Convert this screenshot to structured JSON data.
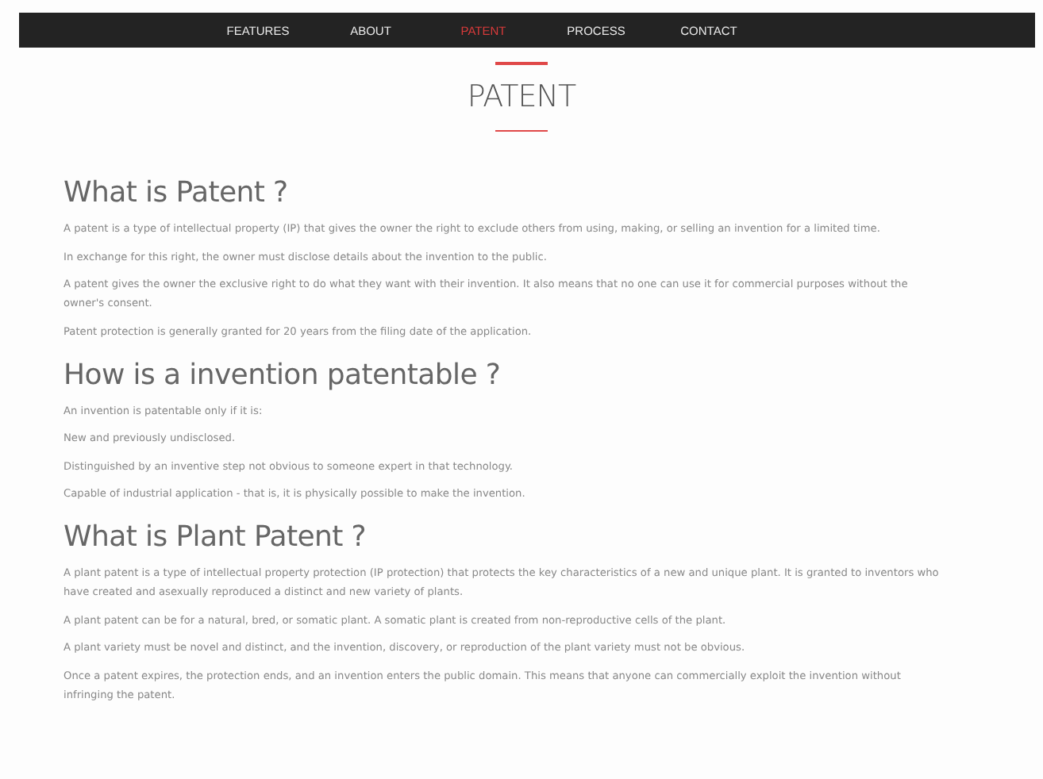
{
  "nav": {
    "items": [
      {
        "label": "FEATURES",
        "selected": false
      },
      {
        "label": "ABOUT",
        "selected": false
      },
      {
        "label": "PATENT",
        "selected": true
      },
      {
        "label": "PROCESS",
        "selected": false
      },
      {
        "label": "CONTACT",
        "selected": false
      }
    ]
  },
  "page_title": "PATENT",
  "sections": [
    {
      "heading": "What is Patent ?",
      "paragraphs": [
        "A patent is a type of intellectual property (IP) that gives the owner the right to exclude others from using, making, or selling an invention for a limited time.",
        "In exchange for this right, the owner must disclose details about the invention to the public.",
        "A patent gives the owner the exclusive right to do what they want with their invention. It also means that no one can use it for commercial purposes without the owner's consent.",
        "Patent protection is generally granted for 20 years from the filing date of the application."
      ]
    },
    {
      "heading": "How is a invention patentable ?",
      "paragraphs": [
        "An invention is patentable only if it is:",
        "New and previously undisclosed.",
        "Distinguished by an inventive step not obvious to someone expert in that technology.",
        "Capable of industrial application - that is, it is physically possible to make the invention."
      ]
    },
    {
      "heading": "What is Plant Patent ?",
      "paragraphs": [
        "A plant patent is a type of intellectual property protection (IP protection) that protects the key characteristics of a new and unique plant. It is granted to inventors who have created and asexually reproduced a distinct and new variety of plants.",
        "A plant patent can be for a natural, bred, or somatic plant. A somatic plant is created from non-reproductive cells of the plant.",
        "A plant variety must be novel and distinct, and the invention, discovery, or reproduction of the plant variety must not be obvious.",
        "Once a patent expires, the protection ends, and an invention enters the public domain. This means that anyone can commercially exploit the invention without infringing the patent."
      ]
    }
  ]
}
